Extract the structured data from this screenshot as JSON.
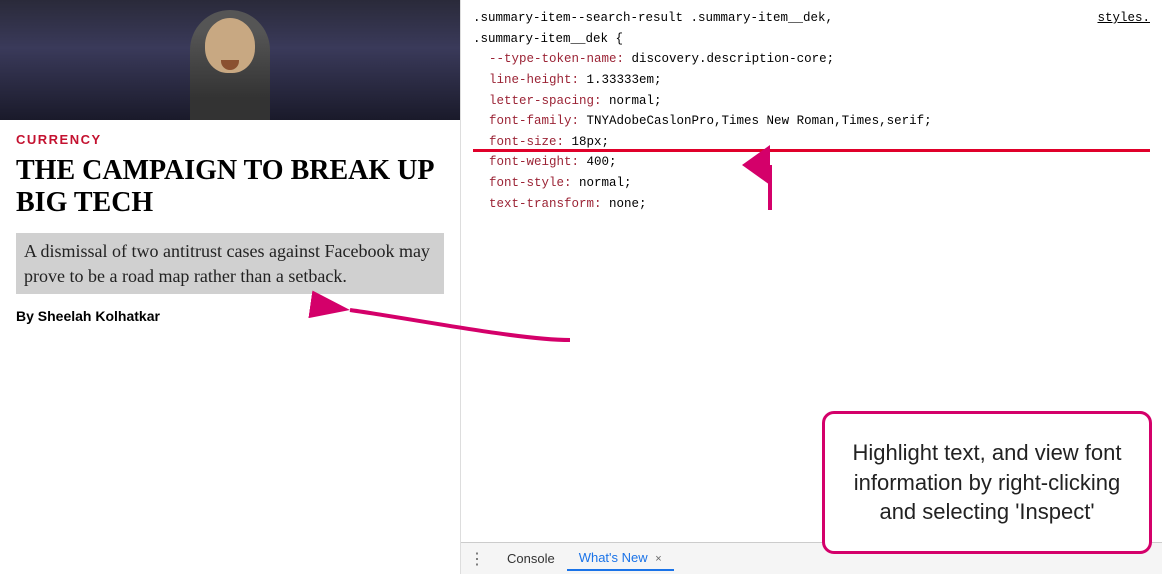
{
  "left": {
    "category": "CURRENCY",
    "title": "THE CAMPAIGN TO BREAK UP BIG TECH",
    "excerpt": "A dismissal of two antitrust cases against Facebook may prove to be a road map rather than a setback.",
    "byline": "By Sheelah Kolhatkar"
  },
  "devtools": {
    "selectors": ".summary-item--search-result .summary-item__dek,",
    "selectors2": ".summary-item__dek {",
    "link": "styles.",
    "properties": [
      {
        "prop": "--type-token-name:",
        "val": " discovery.description-core;"
      },
      {
        "prop": "line-height:",
        "val": " 1.33333em;"
      },
      {
        "prop": "letter-spacing:",
        "val": " normal;"
      },
      {
        "prop": "font-family:",
        "val": " TNYAdobeCaslonPro,Times New Roman,Times,serif;"
      },
      {
        "prop": "font-size:",
        "val": " 18px;"
      },
      {
        "prop": "font-weight:",
        "val": " 400;"
      },
      {
        "prop": "font-style:",
        "val": " normal;"
      },
      {
        "prop": "text-transform:",
        "val": " none;"
      }
    ],
    "closing_brace": "}",
    "tabs": {
      "console": "Console",
      "whats_new": "What's New",
      "close": "×"
    }
  },
  "callout": {
    "text": "Highlight text, and view font information by right-clicking and selecting 'Inspect'"
  }
}
